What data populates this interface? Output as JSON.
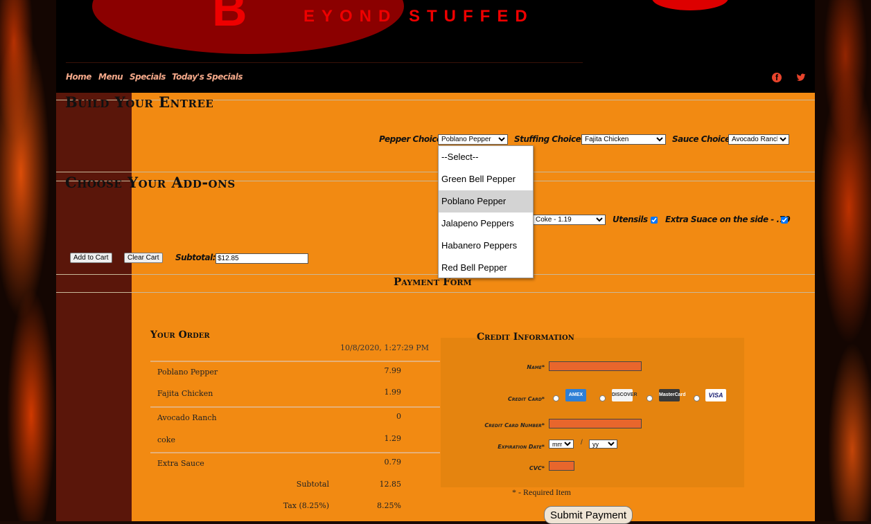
{
  "logo": {
    "letter": "B",
    "text": "EYOND STUFFED"
  },
  "nav": {
    "items": [
      "Home",
      "Menu",
      "Specials",
      "Today's Specials"
    ]
  },
  "social": {
    "facebook_icon": "facebook-icon",
    "twitter_icon": "twitter-icon"
  },
  "build": {
    "title": "Build Your Entree",
    "pepper_label": "Pepper Choice:",
    "pepper_value": "Poblano Pepper",
    "stuffing_label": "Stuffing Choice:",
    "stuffing_value": "Fajita Chicken",
    "sauce_label": "Sauce Choice:",
    "sauce_value": "Avocado Ranch"
  },
  "pepper_dropdown": {
    "options": [
      "--Select--",
      "Green Bell Pepper",
      "Poblano Pepper",
      "Jalapeno Peppers",
      "Habanero Peppers",
      "Red Bell Pepper"
    ],
    "selected_index": 2
  },
  "addons": {
    "title": "Choose Your Add-ons",
    "drink_value": "Coke - 1.19",
    "utensils_label": "Utensils",
    "extra_sauce_label": "Extra Suace on the side - .79",
    "add_to_cart": "Add to Cart",
    "clear_cart": "Clear Cart",
    "subtotal_label": "Subtotal:",
    "subtotal_value": "$12.85"
  },
  "payment": {
    "title": "Payment Form",
    "order_title": "Your Order",
    "order_date": "10/8/2020, 1:27:29 PM",
    "items": [
      {
        "name": "Poblano Pepper",
        "price": "7.99"
      },
      {
        "name": "Fajita Chicken",
        "price": "1.99"
      },
      {
        "name": "Avocado Ranch",
        "price": "0"
      },
      {
        "name": "coke",
        "price": "1.29"
      },
      {
        "name": "Extra Sauce",
        "price": "0.79"
      }
    ],
    "subtotal_label": "Subtotal",
    "subtotal_value": "12.85",
    "tax_label": "Tax (8.25%)",
    "tax_value": "8.25%"
  },
  "credit": {
    "title": "Credit Information",
    "name_label": "Name*",
    "card_label": "Credit Card*",
    "cards": [
      "AMEX",
      "DISCOVER",
      "MasterCard",
      "VISA"
    ],
    "number_label": "Credit Card Number*",
    "exp_label": "Expiration Date*",
    "month_placeholder": "mm",
    "year_placeholder": "yy",
    "exp_sep": "/",
    "cvc_label": "CVC*",
    "required_note": "* - Required Item",
    "submit": "Submit Payment"
  }
}
